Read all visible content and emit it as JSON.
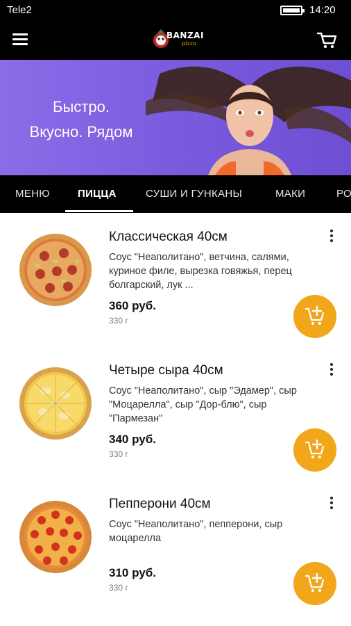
{
  "status_bar": {
    "carrier": "Tele2",
    "time": "14:20",
    "battery_level": 1.0
  },
  "app_bar": {
    "logo_text": "BANZAI",
    "logo_sub": "pizza"
  },
  "banner": {
    "line1": "Быстро.",
    "line2": "Вкусно. Рядом",
    "background": "#7a5bde"
  },
  "tabs": [
    {
      "label": "МЕНЮ",
      "active": false
    },
    {
      "label": "ПИЦЦА",
      "active": true
    },
    {
      "label": "СУШИ И ГУНКАНЫ",
      "active": false
    },
    {
      "label": "МАКИ",
      "active": false
    },
    {
      "label": "РО",
      "active": false
    }
  ],
  "accent_color": "#f2a71b",
  "products": [
    {
      "title": "Классическая 40см",
      "description": "Соус \"Неаполитано\", ветчина, салями, куриное филе, вырезка говяжья, перец болгарский, лук ...",
      "price": "360 руб.",
      "weight": "330 г",
      "image": "pizza-classic"
    },
    {
      "title": "Четыре сыра 40см",
      "description": "Соус \"Неаполитано\", сыр \"Эдамер\", сыр \"Моцарелла\", сыр \"Дор-блю\", сыр \"Пармезан\"",
      "price": "340 руб.",
      "weight": "330 г",
      "image": "pizza-four-cheese"
    },
    {
      "title": "Пепперони 40см",
      "description": "Соус \"Неаполитано\", пепперони, сыр моцарелла",
      "price": "310 руб.",
      "weight": "330 г",
      "image": "pizza-pepperoni"
    }
  ]
}
